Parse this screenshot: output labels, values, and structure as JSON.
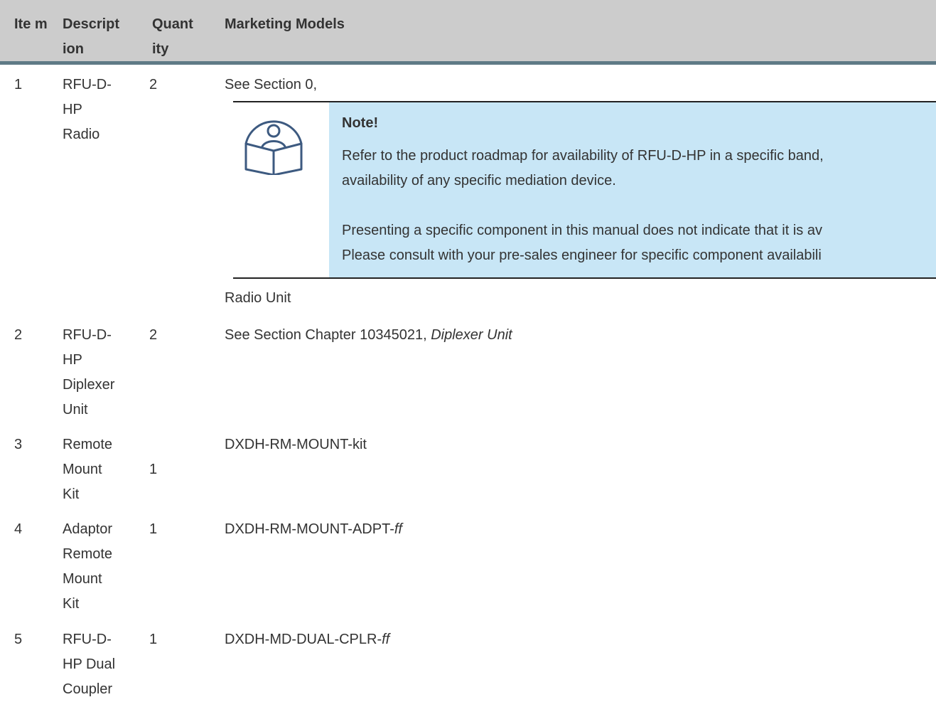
{
  "header": {
    "item": "Ite m",
    "description": "Descript ion",
    "quantity": "Quant ity",
    "models": "Marketing Models"
  },
  "rows": [
    {
      "item": "1",
      "description_lines": [
        "RFU-D-",
        "HP",
        "Radio"
      ],
      "quantity": "2",
      "model": "See Section 0,"
    },
    {
      "item": "2",
      "description_lines": [
        "RFU-D-",
        "HP",
        "Diplexer",
        "Unit"
      ],
      "quantity": "2",
      "model_prefix": "See Section Chapter 10345021, ",
      "model_italic": "Diplexer Unit"
    },
    {
      "item": "3",
      "description_lines": [
        "Remote",
        "Mount",
        "Kit"
      ],
      "quantity": "1",
      "model": "DXDH-RM-MOUNT-kit"
    },
    {
      "item": "4",
      "description_lines": [
        "Adaptor",
        "Remote",
        "Mount",
        "Kit"
      ],
      "quantity": "1",
      "model_prefix": "DXDH-RM-MOUNT-ADPT-",
      "model_italic": "ff"
    },
    {
      "item": "5",
      "description_lines": [
        "RFU-D-",
        "HP Dual",
        "Coupler"
      ],
      "quantity": "1",
      "model_prefix": "DXDH-MD-DUAL-CPLR-",
      "model_italic": "ff"
    }
  ],
  "note": {
    "icon": "book-reader-icon",
    "title": "Note!",
    "line1": "Refer to the product roadmap for availability of RFU-D-HP in a specific band,",
    "line2": "availability of any specific mediation device.",
    "line3": "Presenting a specific component in this manual does not indicate that it is av",
    "line4": "Please consult with your pre-sales engineer for specific component availabili"
  },
  "after_note": "Radio Unit",
  "colors": {
    "header_bg": "#cccccc",
    "header_rule": "#5f7a86",
    "note_bg": "#c8e6f6",
    "icon_stroke": "#3d5a80"
  }
}
